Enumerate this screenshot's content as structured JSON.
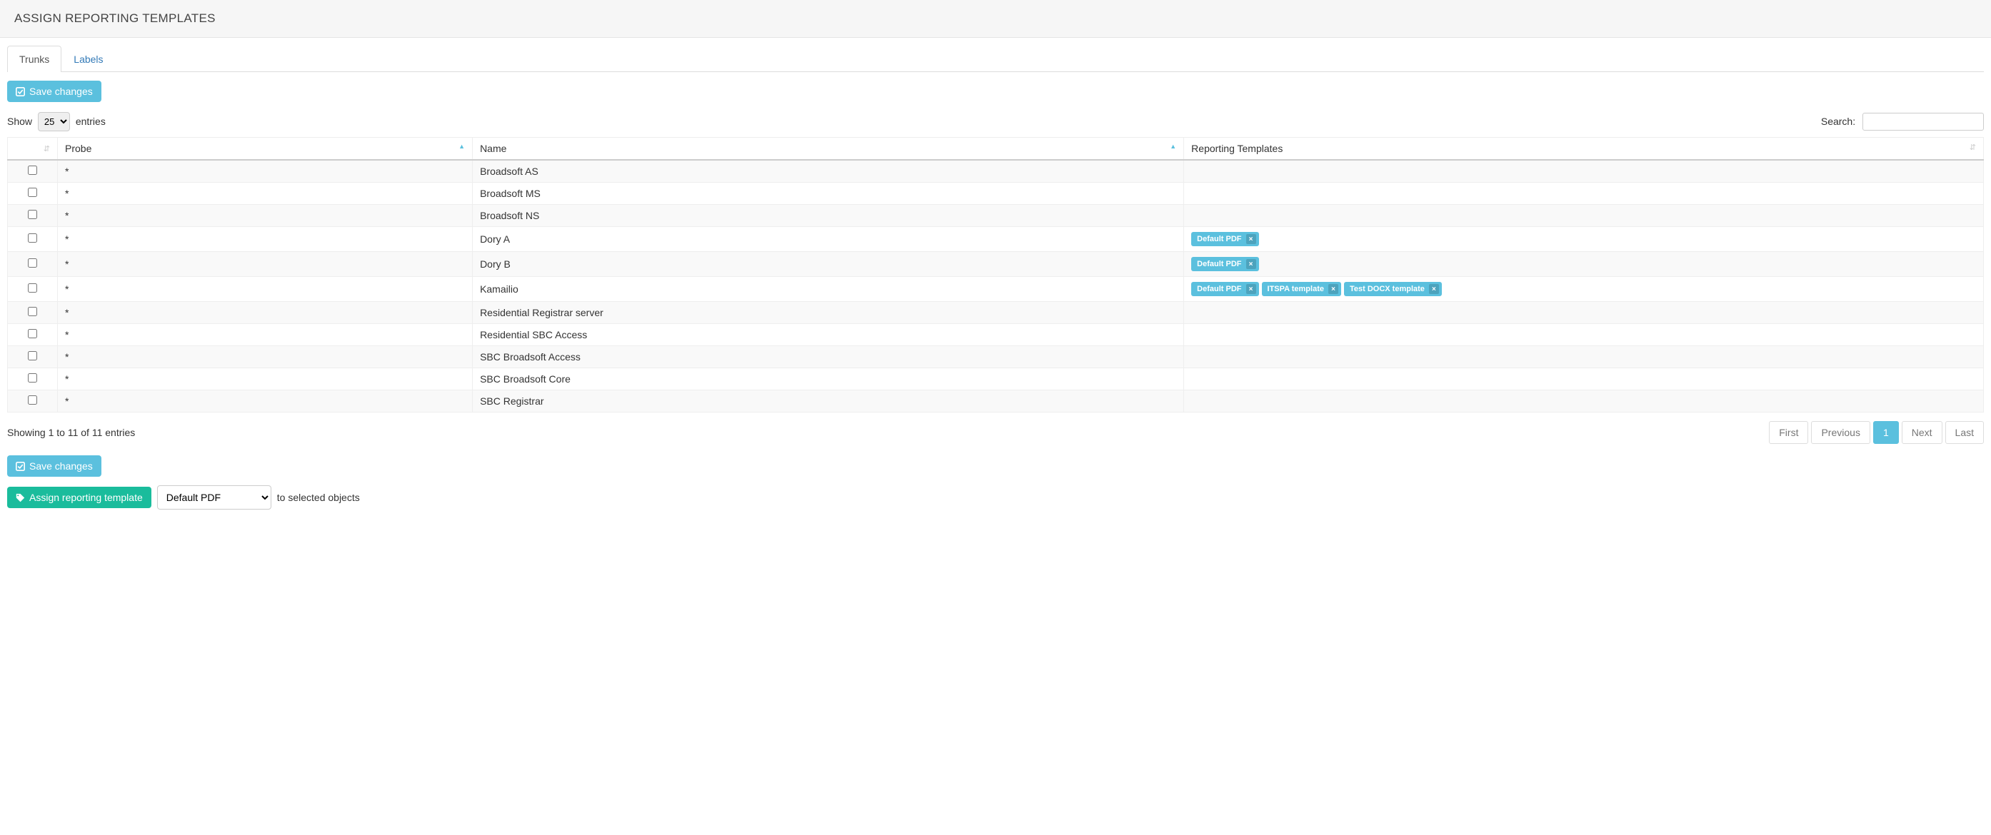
{
  "header": {
    "title": "ASSIGN REPORTING TEMPLATES"
  },
  "tabs": [
    {
      "label": "Trunks",
      "active": true
    },
    {
      "label": "Labels",
      "active": false
    }
  ],
  "buttons": {
    "save_top": "Save changes",
    "save_bottom": "Save changes",
    "assign": "Assign reporting template"
  },
  "entries_control": {
    "show_label": "Show",
    "entries_label": "entries",
    "value": "25"
  },
  "search": {
    "label": "Search:",
    "value": ""
  },
  "columns": {
    "checkbox": "",
    "probe": "Probe",
    "name": "Name",
    "templates": "Reporting Templates"
  },
  "rows": [
    {
      "probe": "*",
      "name": "Broadsoft AS",
      "templates": []
    },
    {
      "probe": "*",
      "name": "Broadsoft MS",
      "templates": []
    },
    {
      "probe": "*",
      "name": "Broadsoft NS",
      "templates": []
    },
    {
      "probe": "*",
      "name": "Dory A",
      "templates": [
        "Default PDF"
      ]
    },
    {
      "probe": "*",
      "name": "Dory B",
      "templates": [
        "Default PDF"
      ]
    },
    {
      "probe": "*",
      "name": "Kamailio",
      "templates": [
        "Default PDF",
        "ITSPA template",
        "Test DOCX template"
      ]
    },
    {
      "probe": "*",
      "name": "Residential Registrar server",
      "templates": []
    },
    {
      "probe": "*",
      "name": "Residential SBC Access",
      "templates": []
    },
    {
      "probe": "*",
      "name": "SBC Broadsoft Access",
      "templates": []
    },
    {
      "probe": "*",
      "name": "SBC Broadsoft Core",
      "templates": []
    },
    {
      "probe": "*",
      "name": "SBC Registrar",
      "templates": []
    }
  ],
  "footer": {
    "info": "Showing 1 to 11 of 11 entries"
  },
  "pagination": {
    "first": "First",
    "previous": "Previous",
    "current": "1",
    "next": "Next",
    "last": "Last"
  },
  "assign_row": {
    "selected_template": "Default PDF",
    "suffix": "to selected objects"
  }
}
